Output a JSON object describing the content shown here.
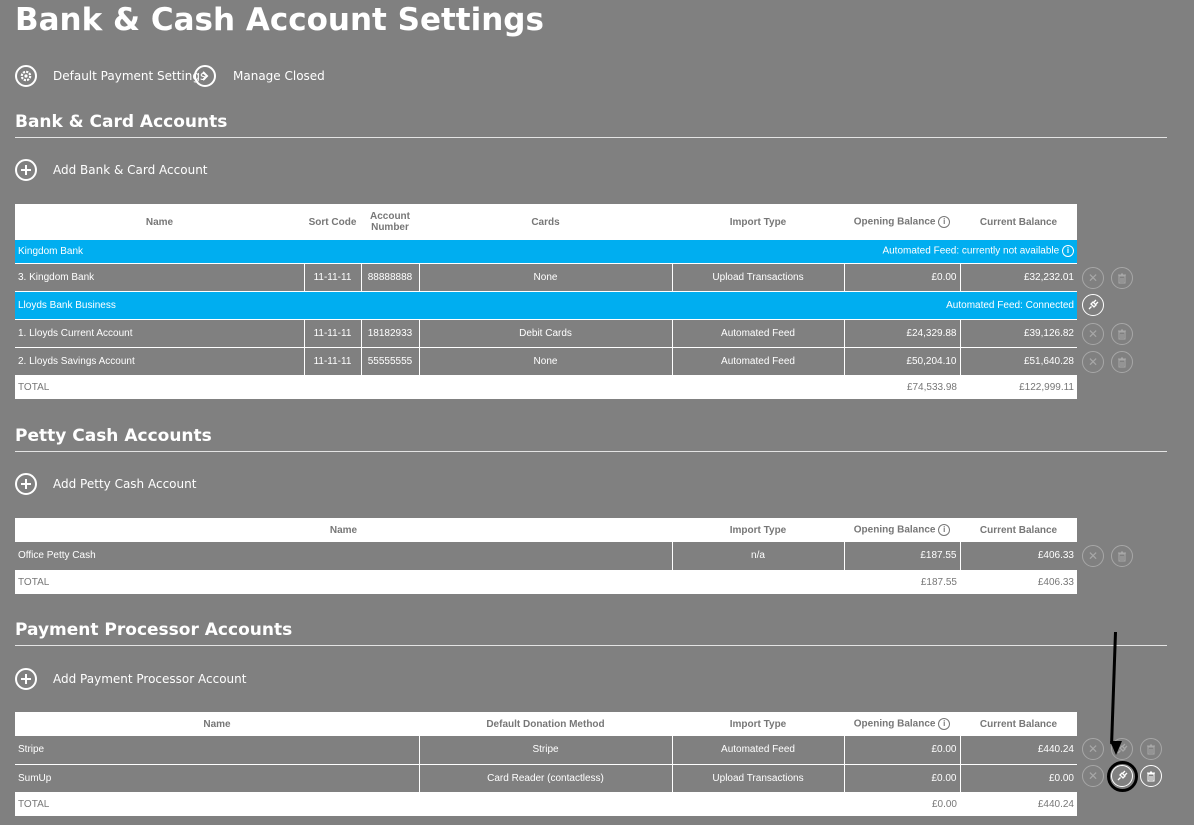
{
  "page_title": "Bank & Cash Account Settings",
  "toolbar": {
    "default_payment": "Default Payment Settings",
    "manage_closed": "Manage Closed"
  },
  "bank_section": {
    "title": "Bank & Card Accounts",
    "add_label": "Add Bank & Card Account",
    "headers": {
      "name": "Name",
      "sort_code": "Sort Code",
      "account_number": "Account Number",
      "cards": "Cards",
      "import_type": "Import Type",
      "opening_balance": "Opening Balance",
      "current_balance": "Current Balance"
    },
    "groups": [
      {
        "bank": "Kingdom Bank",
        "feed_status": "Automated Feed: currently not available",
        "accounts": [
          {
            "name": "3. Kingdom Bank",
            "sort_code": "11-11-11",
            "account_number": "88888888",
            "cards": "None",
            "import_type": "Upload Transactions",
            "opening": "£0.00",
            "current": "£32,232.01"
          }
        ]
      },
      {
        "bank": "Lloyds Bank Business",
        "feed_status": "Automated Feed: Connected",
        "accounts": [
          {
            "name": "1. Lloyds Current Account",
            "sort_code": "11-11-11",
            "account_number": "18182933",
            "cards": "Debit Cards",
            "import_type": "Automated Feed",
            "opening": "£24,329.88",
            "current": "£39,126.82"
          },
          {
            "name": "2. Lloyds Savings Account",
            "sort_code": "11-11-11",
            "account_number": "55555555",
            "cards": "None",
            "import_type": "Automated Feed",
            "opening": "£50,204.10",
            "current": "£51,640.28"
          }
        ]
      }
    ],
    "total_label": "TOTAL",
    "total_opening": "£74,533.98",
    "total_current": "£122,999.11"
  },
  "petty_section": {
    "title": "Petty Cash Accounts",
    "add_label": "Add Petty Cash Account",
    "headers": {
      "name": "Name",
      "import_type": "Import Type",
      "opening_balance": "Opening Balance",
      "current_balance": "Current Balance"
    },
    "rows": [
      {
        "name": "Office Petty Cash",
        "import_type": "n/a",
        "opening": "£187.55",
        "current": "£406.33"
      }
    ],
    "total_label": "TOTAL",
    "total_opening": "£187.55",
    "total_current": "£406.33"
  },
  "processor_section": {
    "title": "Payment Processor Accounts",
    "add_label": "Add Payment Processor Account",
    "headers": {
      "name": "Name",
      "method": "Default Donation Method",
      "import_type": "Import Type",
      "opening_balance": "Opening Balance",
      "current_balance": "Current Balance"
    },
    "rows": [
      {
        "name": "Stripe",
        "method": "Stripe",
        "import_type": "Automated Feed",
        "opening": "£0.00",
        "current": "£440.24"
      },
      {
        "name": "SumUp",
        "method": "Card Reader (contactless)",
        "import_type": "Upload Transactions",
        "opening": "£0.00",
        "current": "£0.00"
      }
    ],
    "total_label": "TOTAL",
    "total_opening": "£0.00",
    "total_current": "£440.24"
  },
  "colors": {
    "background": "#808080",
    "bank_row": "#00aef0",
    "header_bg": "#ffffff"
  },
  "icons": {
    "settings": "gear-icon",
    "manage_closed": "chevron-right-icon",
    "add": "plus-icon",
    "close_account": "x-icon",
    "delete": "trash-icon",
    "feed": "plug-icon",
    "info": "info-icon"
  }
}
